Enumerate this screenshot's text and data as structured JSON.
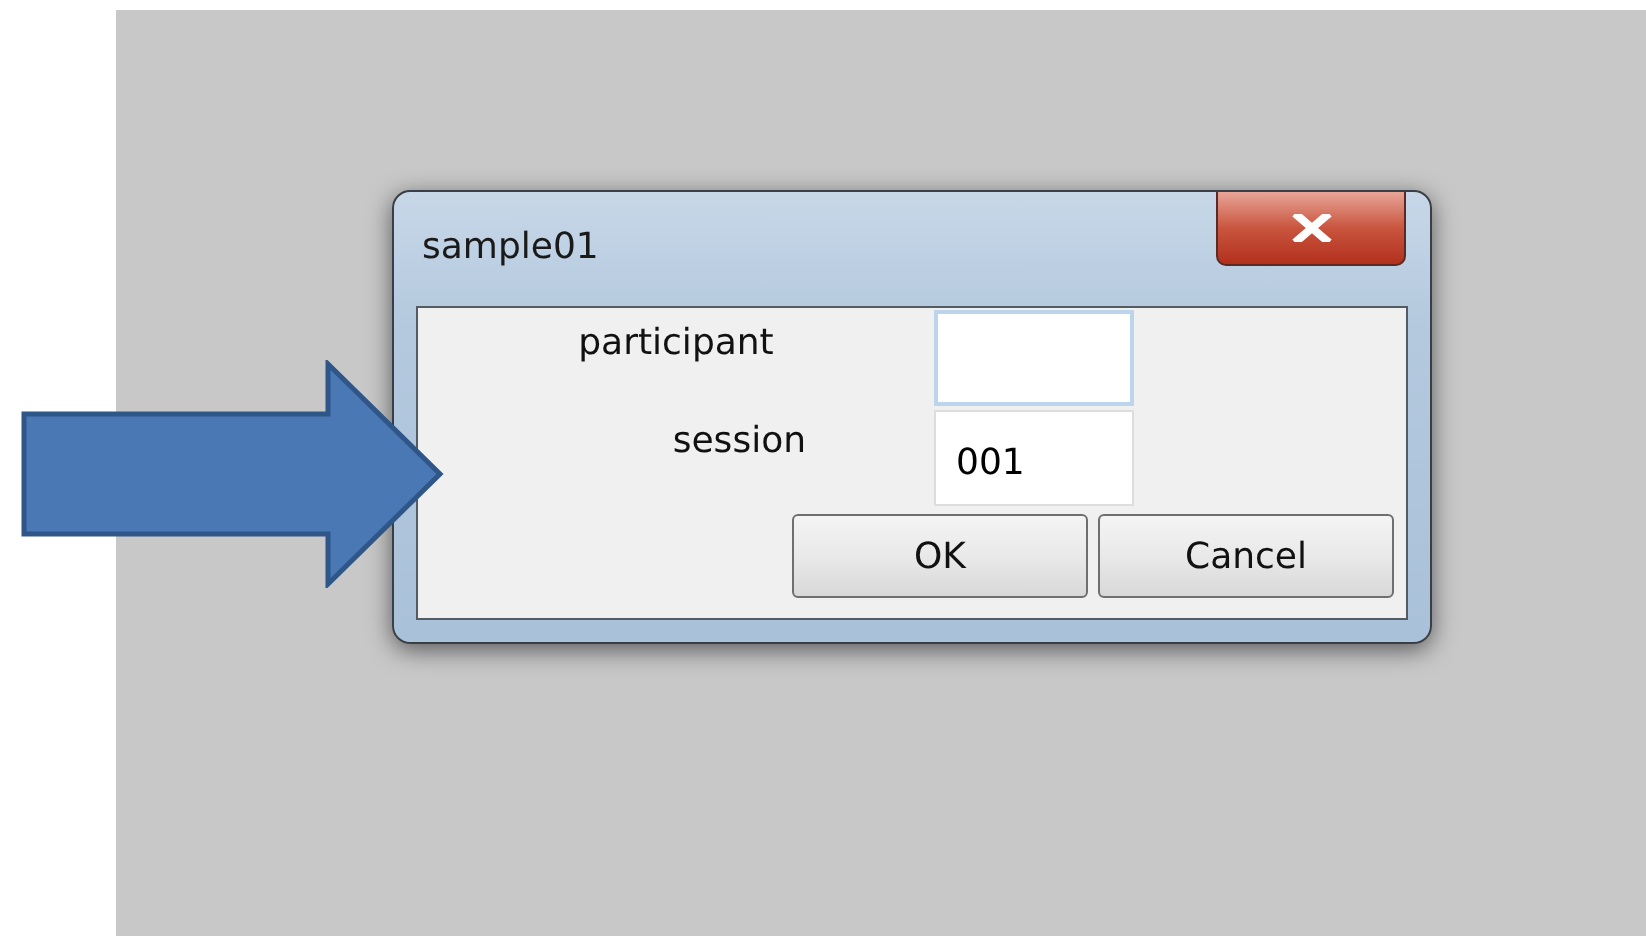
{
  "window": {
    "title": "sample01"
  },
  "fields": [
    {
      "label": "participant"
    },
    {
      "label": "session",
      "value": "001"
    }
  ],
  "buttons": [
    "OK",
    "Cancel"
  ]
}
